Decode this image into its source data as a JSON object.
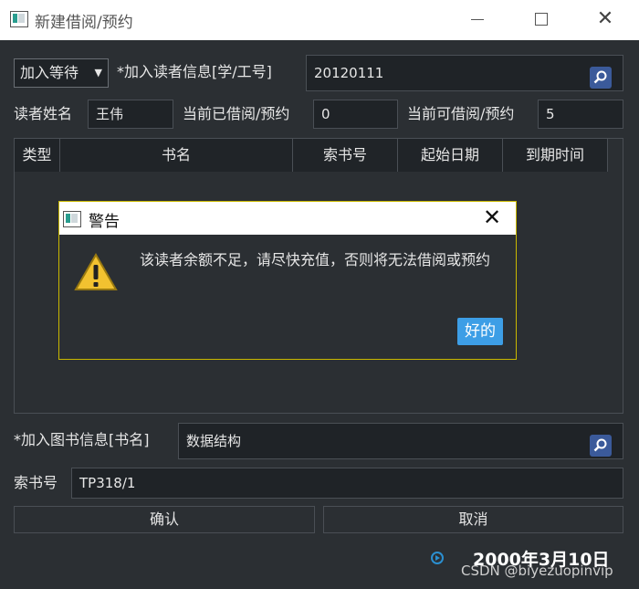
{
  "window": {
    "title": "新建借阅/预约"
  },
  "top": {
    "mode_selected": "加入等待",
    "reader_label": "*加入读者信息[学/工号]",
    "reader_value": "20120111"
  },
  "reader": {
    "name_label": "读者姓名",
    "name_value": "王伟",
    "borrowed_label": "当前已借阅/预约",
    "borrowed_value": "0",
    "available_label": "当前可借阅/预约",
    "available_value": "5"
  },
  "table": {
    "columns": [
      "类型",
      "书名",
      "索书号",
      "起始日期",
      "到期时间"
    ]
  },
  "dialog": {
    "title": "警告",
    "message": "该读者余额不足，请尽快充值，否则将无法借阅或预约",
    "ok_label": "好的"
  },
  "book": {
    "label": "*加入图书信息[书名]",
    "value": "数据结构"
  },
  "call_number": {
    "label": "索书号",
    "value": "TP318/1"
  },
  "actions": {
    "confirm_label": "确认",
    "cancel_label": "取消"
  },
  "footer": {
    "date": "2000年3月10日",
    "watermark": "CSDN @biyezuopinvip"
  },
  "colors": {
    "accent": "#3d9ee6",
    "dialog_border": "#c9b800",
    "background": "#2b2f33"
  },
  "icons": [
    "app-icon",
    "search-icon",
    "warning-icon",
    "close-icon",
    "play-icon"
  ]
}
